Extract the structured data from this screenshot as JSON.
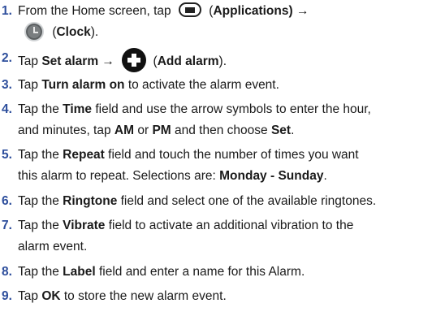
{
  "steps": [
    {
      "num": "1.",
      "l1_a": "From the Home screen, tap",
      "l1_b": "(",
      "l1_c": "Applications",
      "l1_d": ") →",
      "l2_a": "(",
      "l2_b": "Clock",
      "l2_c": ")."
    },
    {
      "num": "2.",
      "a": "Tap ",
      "b": "Set alarm →",
      "c": "(",
      "d": "Add alarm",
      "e": ")."
    },
    {
      "num": "3.",
      "a": "Tap ",
      "b": "Turn alarm on",
      "c": " to activate the alarm event."
    },
    {
      "num": "4.",
      "l1_a": "Tap the ",
      "l1_b": "Time",
      "l1_c": " field and use the arrow symbols to enter the hour,",
      "l2_a": "and minutes, tap ",
      "l2_b": "AM",
      "l2_c": " or ",
      "l2_d": "PM",
      "l2_e": " and then choose ",
      "l2_f": "Set",
      "l2_g": "."
    },
    {
      "num": "5.",
      "l1_a": "Tap the ",
      "l1_b": "Repeat",
      "l1_c": " field and touch the number of times you want",
      "l2_a": "this alarm to repeat. Selections are: ",
      "l2_b": "Monday - Sunday",
      "l2_c": "."
    },
    {
      "num": "6.",
      "a": "Tap the ",
      "b": "Ringtone",
      "c": " field and select one of the available ringtones."
    },
    {
      "num": "7.",
      "l1_a": "Tap the ",
      "l1_b": "Vibrate",
      "l1_c": " field to activate an additional vibration to the",
      "l2_a": "alarm event."
    },
    {
      "num": "8.",
      "a": "Tap the ",
      "b": "Label",
      "c": " field and enter a name for this Alarm."
    },
    {
      "num": "9.",
      "a": "Tap ",
      "b": "OK",
      "c": " to store the new alarm event."
    }
  ],
  "icons": [
    "applications-icon",
    "clock-icon",
    "add-alarm-icon"
  ],
  "colors": {
    "step_number": "#2d4e9c",
    "text": "#1a1a1a"
  }
}
